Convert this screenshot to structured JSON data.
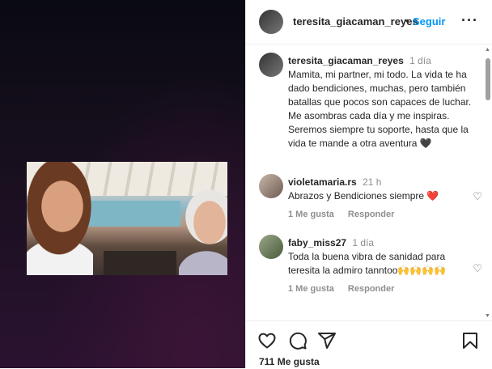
{
  "post": {
    "username": "teresita_giacaman_reyes",
    "follow_label": "Seguir",
    "separator": "•",
    "more_label": "···"
  },
  "caption": {
    "username": "teresita_giacaman_reyes",
    "time": "1 día",
    "text": "Mamita, mi partner, mi todo. La vida te ha dado bendiciones, muchas, pero también batallas que pocos son capaces de luchar. Me asombras cada día y me inspiras. Seremos siempre tu soporte, hasta que la vida te mande a otra aventura 🖤"
  },
  "comments": [
    {
      "username": "violetamaria.rs",
      "time": "21 h",
      "text": "Abrazos y Bendiciones siempre ❤️",
      "likes_label": "1 Me gusta",
      "reply_label": "Responder"
    },
    {
      "username": "faby_miss27",
      "time": "1 día",
      "text": "Toda la buena vibra de sanidad para teresita la admiro tanntoo🙌🙌🙌🙌",
      "likes_label": "1 Me gusta",
      "reply_label": "Responder"
    }
  ],
  "footer": {
    "likes": "711 Me gusta"
  },
  "icons": {
    "like": "heart-icon",
    "comment": "comment-icon",
    "share": "share-icon",
    "save": "bookmark-icon"
  },
  "colors": {
    "link": "#0095f6",
    "heart_red": "#ed4956"
  }
}
